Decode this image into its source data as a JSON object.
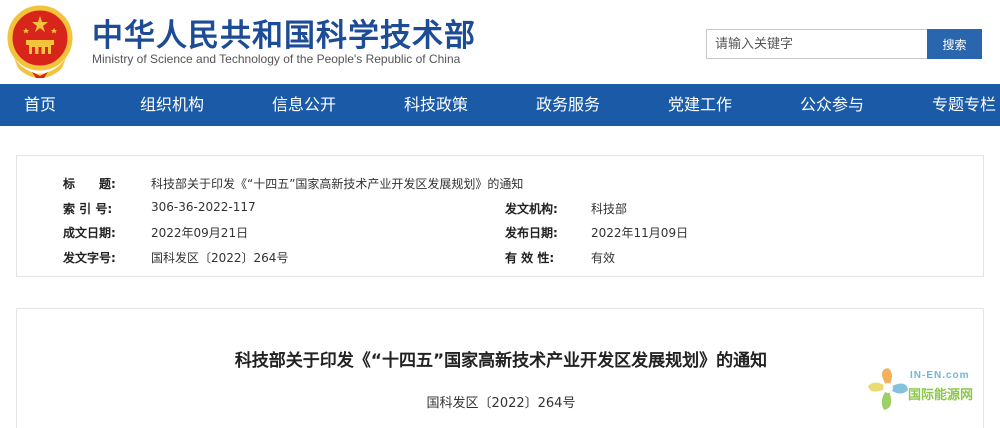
{
  "header": {
    "title": "中华人民共和国科学技术部",
    "subtitle": "Ministry of Science and Technology of the People's Republic of China",
    "search_placeholder": "请输入关键字",
    "search_button": "搜索"
  },
  "nav": {
    "items": [
      "首页",
      "组织机构",
      "信息公开",
      "科技政策",
      "政务服务",
      "党建工作",
      "公众参与",
      "专题专栏"
    ]
  },
  "meta": {
    "title_label": "标　　题:",
    "title_value": "科技部关于印发《“十四五”国家高新技术产业开发区发展规划》的通知",
    "index_label": "索 引 号:",
    "index_value": "306-36-2022-117",
    "issuer_label": "发文机构:",
    "issuer_value": "科技部",
    "written_label": "成文日期:",
    "written_value": "2022年09月21日",
    "published_label": "发布日期:",
    "published_value": "2022年11月09日",
    "docno_label": "发文字号:",
    "docno_value": "国科发区〔2022〕264号",
    "validity_label": "有 效 性:",
    "validity_value": "有效"
  },
  "article": {
    "title": "科技部关于印发《“十四五”国家高新技术产业开发区发展规划》的通知",
    "doc_number": "国科发区〔2022〕264号"
  },
  "watermark": {
    "line1": "IN-EN.com",
    "line2": "国际能源网"
  },
  "colors": {
    "nav_bg": "#1a5aa6",
    "title_blue": "#1d4c96",
    "emblem_red": "#d8251c",
    "emblem_gold": "#f3c33b"
  }
}
